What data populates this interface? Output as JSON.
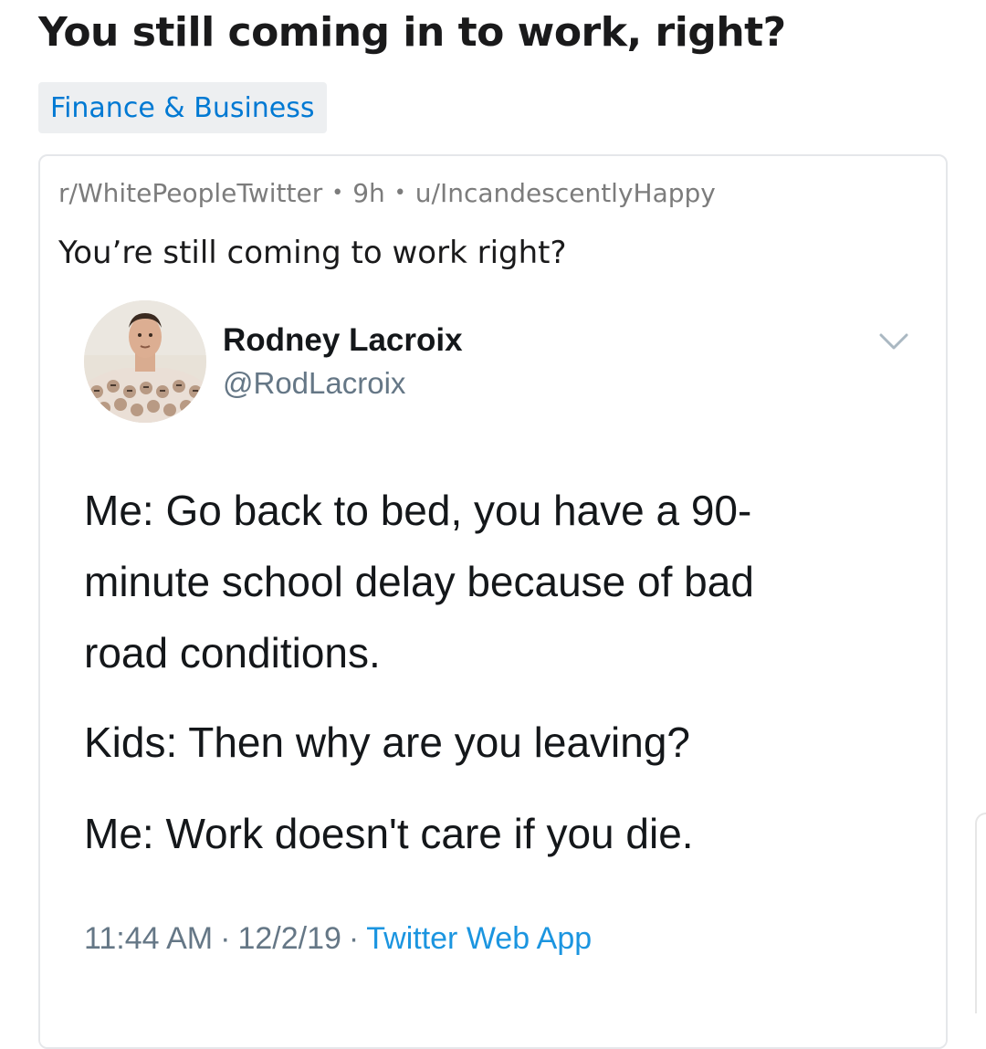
{
  "post": {
    "title": "You still coming in to work, right?",
    "flair": "Finance & Business"
  },
  "crosspost": {
    "subreddit": "r/WhitePeopleTwitter",
    "age": "9h",
    "author": "u/IncandescentlyHappy",
    "separator": "•",
    "title": "You’re still coming to work right?"
  },
  "tweet": {
    "author_name": "Rodney Lacroix",
    "author_handle": "@RodLacroix",
    "lines": [
      "Me: Go back to bed, you have a 90-",
      "minute school delay because of bad",
      "road conditions.",
      "Kids: Then why are you leaving?",
      "Me: Work doesn't care if you die."
    ],
    "time": "11:44 AM",
    "date": "12/2/19",
    "separator": "·",
    "source": "Twitter Web App",
    "menu_icon": "chevron-down-icon",
    "avatar_icon": "user-avatar"
  },
  "colors": {
    "flair_text": "#0079d3",
    "flair_bg": "#edeff1",
    "twitter_link": "#1b95e0",
    "meta_gray": "#7c7c7c",
    "handle_gray": "#657786"
  }
}
